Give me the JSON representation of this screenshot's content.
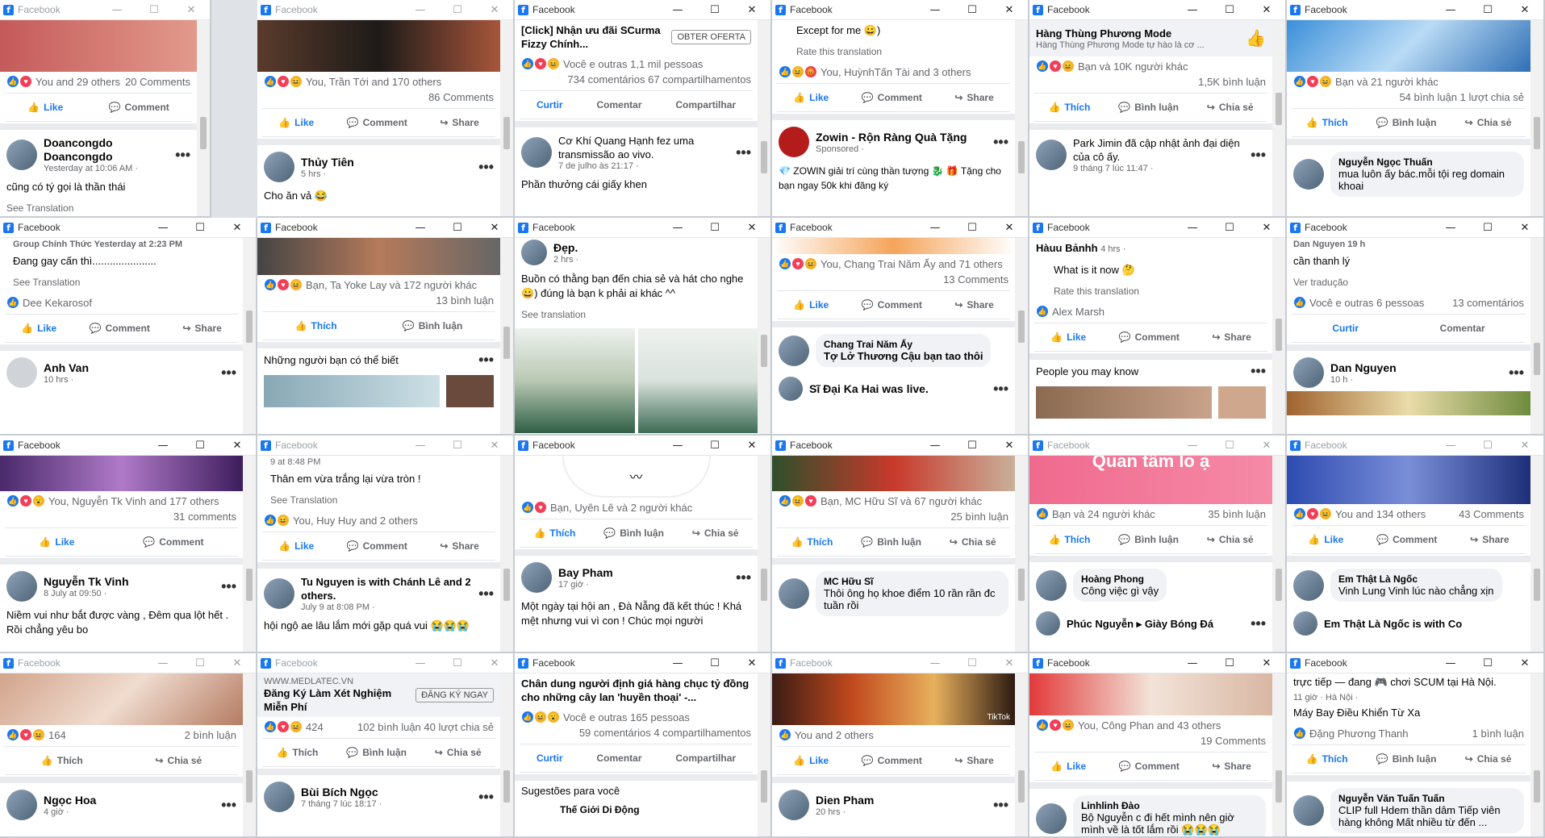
{
  "window_title": "Facebook",
  "controls": {
    "min": "—",
    "max": "☐",
    "close": "✕"
  },
  "w1": {
    "stats_left": "You and 29 others",
    "stats_right": "20 Comments",
    "actions": [
      "Like",
      "Comment"
    ],
    "post_name": "Doancongdo Doancongdo",
    "post_meta": "Yesterday at 10:06 AM ·",
    "post_text": "cũng có tý gọi là thần thái",
    "see": "See Translation"
  },
  "w2": {
    "stats_left": "You, Trần Tới and 170 others",
    "stats_right": "86 Comments",
    "actions": [
      "Like",
      "Comment",
      "Share"
    ],
    "post_name": "Thủy Tiên",
    "post_meta": "5 hrs ·",
    "post_text": "Cho ăn vả 😂",
    "see": "See Translation"
  },
  "w3": {
    "headline": "[Click] Nhận ưu đãi SCurma Fizzy Chính...",
    "cta": "OBTER OFERTA",
    "stats_left": "Você e outras 1,1 mil pessoas",
    "stats_right": "734 comentários  67 compartilhamentos",
    "actions": [
      "Curtir",
      "Comentar",
      "Compartilhar"
    ],
    "post_name": "Cơ Khí Quang Hạnh fez uma transmissão ao vivo.",
    "post_meta": "7 de julho às 21:17 ·",
    "post_text": "Phần thưởng cái giấy khen"
  },
  "w4": {
    "comment": "Except for me 😀)",
    "rate": "Rate this translation",
    "stats_left": "You, HuỳnhTấn Tài and 3 others",
    "actions": [
      "Like",
      "Comment",
      "Share"
    ],
    "post_name": "Zowin - Rộn Ràng Quà Tặng",
    "post_meta": "Sponsored ·",
    "post_text": "💎 ZOWIN giải trí cùng thần tượng 🐉 🎁 Tặng cho bạn ngay 50k khi đăng ký"
  },
  "w5": {
    "page_title": "Hàng Thùng Phương Mode",
    "page_sub": "Hàng Thùng Phương Mode tự hào là cơ ...",
    "stats_left": "Bạn và 10K người khác",
    "stats_right": "1,5K bình luận",
    "actions": [
      "Thích",
      "Bình luận",
      "Chia sẻ"
    ],
    "post_name": "Park Jimin đã cập nhật ảnh đại diện của cô ấy.",
    "post_meta": "9 tháng 7 lúc 11:47 ·"
  },
  "w6": {
    "stats_left": "Bạn và 21 người khác",
    "stats_right": "54 bình luận  1 lượt chia sẻ",
    "actions": [
      "Thích",
      "Bình luận",
      "Chia sẻ"
    ],
    "c_name": "Nguyễn Ngọc Thuấn",
    "c_text": "mua luôn ấy bác.mỗi tội reg domain khoai"
  },
  "w7": {
    "top": "Group Chính Thức  Yesterday at 2:23 PM",
    "post_text": "Đang gay cấn thì......................",
    "see": "See Translation",
    "commenter": "Dee Kekarosof",
    "actions": [
      "Like",
      "Comment",
      "Share"
    ],
    "post_name": "Anh Van",
    "post_meta": "10 hrs ·"
  },
  "w8": {
    "stats_left": "Bạn, Ta Yoke Lay và 172 người khác",
    "stats_right": "13 bình luận",
    "actions": [
      "Thích",
      "Bình luận"
    ],
    "section": "Những người bạn có thể biết"
  },
  "w9": {
    "top": "Đẹp.",
    "meta": "2 hrs ·",
    "post_text": "Buồn có thằng bạn đến chia sẻ và hát cho nghe 😀) đúng là bạn k phải ai khác ^^",
    "see": "See translation"
  },
  "w10": {
    "stats_left": "You, Chang Trai Năm Ấy and 71 others",
    "stats_right": "13 Comments",
    "actions": [
      "Like",
      "Comment",
      "Share"
    ],
    "c_name": "Chang Trai Năm Ấy",
    "c_text": "Tợ Lở Thương Cậu bạn tao thôi",
    "post_name": "Sĩ Đại Ka Hai was live."
  },
  "w11": {
    "post_name": "Hàuu Bảnhh",
    "post_meta": "4 hrs ·",
    "comment": "What is it now 🤔",
    "rate": "Rate this translation",
    "commenter": "Alex Marsh",
    "actions": [
      "Like",
      "Comment",
      "Share"
    ],
    "section": "People you may know"
  },
  "w12": {
    "top": "Dan Nguyen  19 h",
    "comment": "cần thanh lý",
    "see": "Ver tradução",
    "stats_left": "Você e outras 6 pessoas",
    "stats_right": "13 comentários",
    "actions": [
      "Curtir",
      "Comentar"
    ],
    "post_name": "Dan Nguyen",
    "post_meta": "10 h ·"
  },
  "w13": {
    "stats_left": "You, Nguyễn Tk Vinh and 177 others",
    "stats_right": "31 comments",
    "actions": [
      "Like",
      "Comment"
    ],
    "post_name": "Nguyễn Tk Vinh",
    "post_meta": "8 July at 09:50 ·",
    "post_text": "Niềm vui như bắt được vàng , Đêm qua lột hết . Rồi chẳng yêu bo"
  },
  "w14": {
    "top": "9 at 8:48 PM",
    "post_text": "Thân em vừa trắng lại vừa tròn !",
    "see": "See Translation",
    "stats_left": "You, Huy Huy and 2 others",
    "actions": [
      "Like",
      "Comment",
      "Share"
    ],
    "post_name": "Tu Nguyen is with Chánh Lê and 2 others.",
    "post_meta": "July 9 at 8:08 PM ·",
    "post_text2": "hội ngộ ae lâu lắm mới gặp quá vui 😭😭😭"
  },
  "w15": {
    "stats_left": "Bạn, Uyên Lê và 2 người khác",
    "actions": [
      "Thích",
      "Bình luận",
      "Chia sẻ"
    ],
    "post_name": "Bay Pham",
    "post_meta": "17 giờ ·",
    "post_text": "Một ngày tại hội an , Đà Nẵng đã kết thúc ! Khá mệt nhưng vui vì con ! Chúc mọi người"
  },
  "w16": {
    "stats_left": "Bạn, MC Hữu Sĩ và 67 người khác",
    "stats_right": "25 bình luận",
    "actions": [
      "Thích",
      "Bình luận",
      "Chia sẻ"
    ],
    "c_name": "MC Hữu Sĩ",
    "c_text": "Thôi ông họ khoe điểm 10 rần rần đc tuần rồi"
  },
  "w17": {
    "banner": "Quan tâm lo ạ",
    "stats_left": "Bạn và 24 người khác",
    "stats_right": "35 bình luận",
    "actions": [
      "Thích",
      "Bình luận",
      "Chia sẻ"
    ],
    "c_name": "Hoàng Phong",
    "c_text": "Công việc gì vậy",
    "post_name": "Phúc Nguyễn ▸ Giày Bóng Đá"
  },
  "w18": {
    "stats_left": "You and 134 others",
    "stats_right": "43 Comments",
    "actions": [
      "Like",
      "Comment",
      "Share"
    ],
    "c_name": "Em Thật Là Ngốc",
    "c_text": "Vinh Lung Vinh lúc nào chẳng xịn",
    "post_name": "Em Thật Là Ngốc is with Co"
  },
  "w19": {
    "stats_left": "164",
    "stats_right": "2 bình luận",
    "actions": [
      "Thích",
      "Chia sẻ"
    ],
    "post_name": "Ngọc Hoa",
    "post_meta": "4 giờ ·"
  },
  "w20": {
    "ad_url": "WWW.MEDLATEC.VN",
    "ad_title": "Đăng Ký Làm Xét Nghiệm Miễn Phí",
    "cta": "ĐĂNG KÝ NGAY",
    "stats_left": "424",
    "stats_right": "102 bình luận  40 lượt chia sẻ",
    "actions": [
      "Thích",
      "Bình luận",
      "Chia sẻ"
    ],
    "post_name": "Bùi Bích Ngọc",
    "post_meta": "7 tháng 7 lúc 18:17 ·"
  },
  "w21": {
    "headline": "Chân dung người định giá hàng chục tỷ đồng cho những cây lan 'huyền thoại' -...",
    "stats_left": "Você e outras 165 pessoas",
    "stats_right": "59 comentários  4 compartilhamentos",
    "actions": [
      "Curtir",
      "Comentar",
      "Compartilhar"
    ],
    "section": "Sugestões para você",
    "post_name": "Thế Giới Di Động"
  },
  "w22": {
    "badge": "TikTok",
    "stats_left": "You and 2 others",
    "actions": [
      "Like",
      "Comment",
      "Share"
    ],
    "post_name": "Dien Pham",
    "post_meta": "20 hrs ·"
  },
  "w23": {
    "stats_left": "You, Công Phan and 43 others",
    "stats_right": "19 Comments",
    "actions": [
      "Like",
      "Comment",
      "Share"
    ],
    "c_name": "Linhlinh Đào",
    "c_text": "Bộ Nguyễn c đi hết mình nên giờ mình về là tốt lắm rồi 😭😭😭"
  },
  "w24": {
    "top": "trực tiếp — đang 🎮 chơi SCUM tại Hà Nội.",
    "meta": "11 giờ · Hà Nội ·",
    "post_text": "Máy Bay Điều Khiển Từ Xa",
    "stats_left": "Đặng Phương Thanh",
    "stats_right": "1 bình luận",
    "actions": [
      "Thích",
      "Bình luận",
      "Chia sẻ"
    ],
    "c_name": "Nguyễn Văn Tuấn Tuấn",
    "c_text": "CLIP full Hdem thần dâm Tiếp viên hàng không Mất nhiều từ đến ..."
  }
}
